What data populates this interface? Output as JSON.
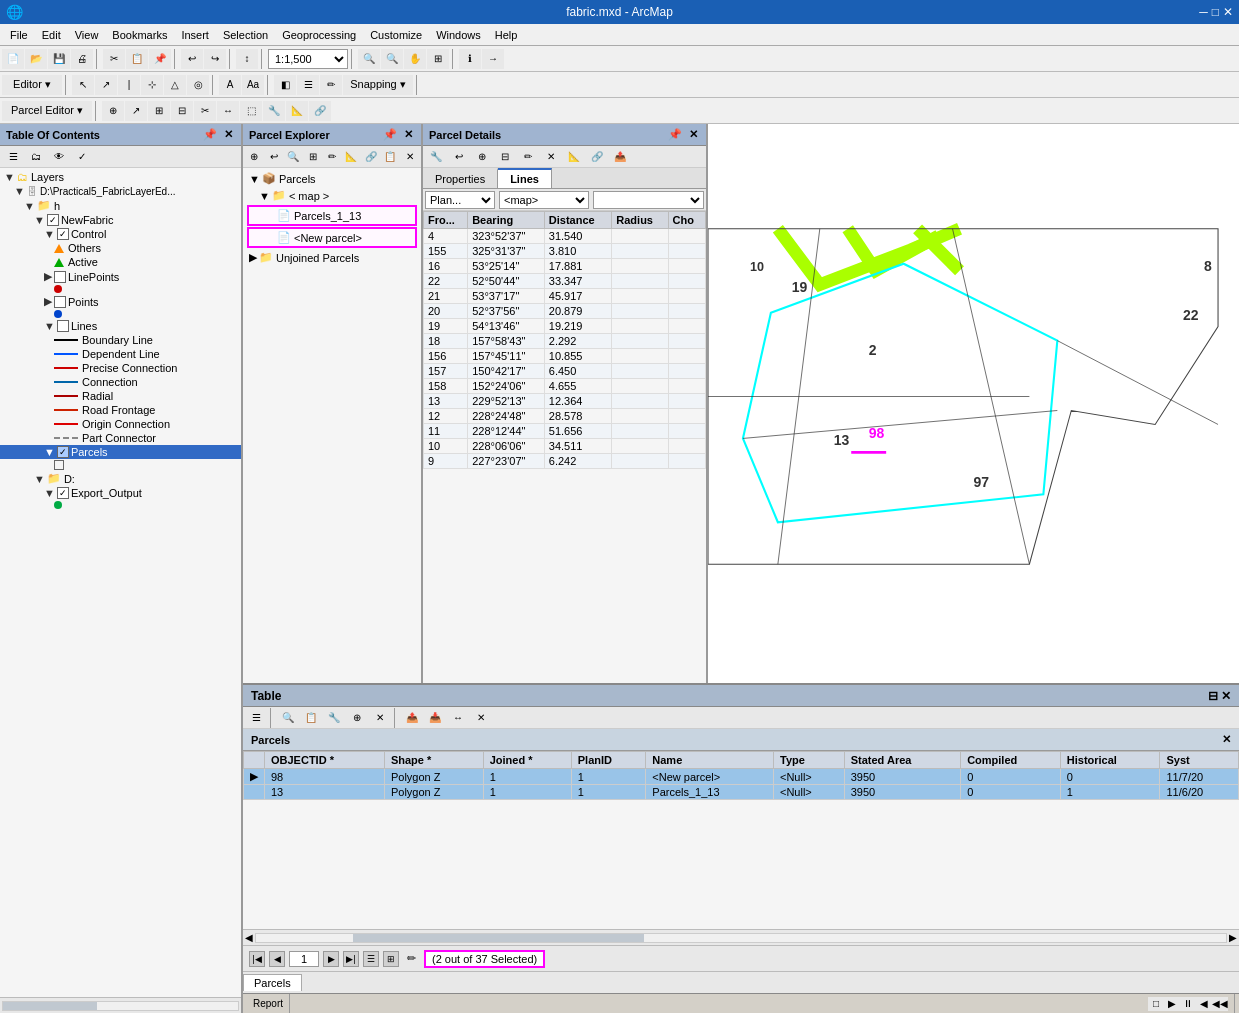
{
  "title": "fabric.mxd - ArcMap",
  "menus": [
    "File",
    "Edit",
    "View",
    "Bookmarks",
    "Insert",
    "Selection",
    "Geoprocessing",
    "Customize",
    "Windows",
    "Help"
  ],
  "toolbar1_dropdown": "1:1,500",
  "toolbar2_label": "Editor ▾",
  "toolbar3_label": "Parcel Editor ▾",
  "snapping_label": "Snapping ▾",
  "toc": {
    "title": "Table Of Contents",
    "sections": [
      {
        "label": "Layers",
        "type": "group",
        "indent": 0
      },
      {
        "label": "D:\\Practical5_FabricLayerEd...",
        "type": "db",
        "indent": 1
      },
      {
        "label": "h",
        "type": "folder",
        "indent": 2
      },
      {
        "label": "NewFabric",
        "type": "layer",
        "checked": true,
        "indent": 3
      },
      {
        "label": "Control",
        "type": "layer",
        "checked": true,
        "indent": 4
      },
      {
        "label": "Others",
        "type": "triangle-orange",
        "indent": 5
      },
      {
        "label": "Active",
        "type": "triangle-green",
        "indent": 5
      },
      {
        "label": "LinePoints",
        "type": "group",
        "checked": false,
        "indent": 4
      },
      {
        "label": "• (red dot)",
        "type": "dot-red",
        "indent": 5
      },
      {
        "label": "Points",
        "type": "group",
        "checked": false,
        "indent": 4
      },
      {
        "label": "• (blue dot)",
        "type": "dot-blue",
        "indent": 5
      },
      {
        "label": "Lines",
        "type": "group",
        "checked": false,
        "indent": 4
      },
      {
        "label": "Boundary Line",
        "type": "line-black",
        "indent": 5
      },
      {
        "label": "Dependent Line",
        "type": "line-blue",
        "indent": 5
      },
      {
        "label": "Precise Connection",
        "type": "line-red",
        "indent": 5
      },
      {
        "label": "Connection",
        "type": "line-blue2",
        "indent": 5
      },
      {
        "label": "Radial",
        "type": "line-red2",
        "indent": 5
      },
      {
        "label": "Road Frontage",
        "type": "line-red3",
        "indent": 5
      },
      {
        "label": "Origin Connection",
        "type": "line-red4",
        "indent": 5
      },
      {
        "label": "Part Connector",
        "type": "line-dash",
        "indent": 5
      },
      {
        "label": "Parcels",
        "type": "layer-blue",
        "checked": true,
        "indent": 4,
        "selected": true
      },
      {
        "label": "□",
        "type": "square",
        "indent": 5
      },
      {
        "label": "D:",
        "type": "folder",
        "indent": 3
      },
      {
        "label": "Export_Output",
        "type": "layer",
        "checked": true,
        "indent": 4
      },
      {
        "label": "● (green)",
        "type": "dot-green",
        "indent": 5
      }
    ]
  },
  "parcel_explorer": {
    "title": "Parcel Explorer",
    "root": "Parcels",
    "items": [
      {
        "label": "< map >",
        "type": "folder",
        "indent": 0
      },
      {
        "label": "Parcels_1_13",
        "type": "parcel",
        "indent": 1,
        "selected_pink": true
      },
      {
        "label": "<New parcel>",
        "type": "parcel",
        "indent": 1,
        "selected_pink": true
      },
      {
        "label": "Unjoined Parcels",
        "type": "folder",
        "indent": 0
      }
    ]
  },
  "parcel_details": {
    "title": "Parcel Details",
    "tabs": [
      "Properties",
      "Lines"
    ],
    "active_tab": "Lines",
    "plan_value": "Plan...",
    "map_value": "<map>",
    "columns": [
      "Fro...",
      "Bearing",
      "Distance",
      "Radius",
      "Cho"
    ],
    "rows": [
      [
        "4",
        "323°52'37\"",
        "31.540",
        "",
        ""
      ],
      [
        "155",
        "325°31'37\"",
        "3.810",
        "",
        ""
      ],
      [
        "16",
        "53°25'14\"",
        "17.881",
        "",
        ""
      ],
      [
        "22",
        "52°50'44\"",
        "33.347",
        "",
        ""
      ],
      [
        "21",
        "53°37'17\"",
        "45.917",
        "",
        ""
      ],
      [
        "20",
        "52°37'56\"",
        "20.879",
        "",
        ""
      ],
      [
        "19",
        "54°13'46\"",
        "19.219",
        "",
        ""
      ],
      [
        "18",
        "157°58'43\"",
        "2.292",
        "",
        ""
      ],
      [
        "156",
        "157°45'11\"",
        "10.855",
        "",
        ""
      ],
      [
        "157",
        "150°42'17\"",
        "6.450",
        "",
        ""
      ],
      [
        "158",
        "152°24'06\"",
        "4.655",
        "",
        ""
      ],
      [
        "13",
        "229°52'13\"",
        "12.364",
        "",
        ""
      ],
      [
        "12",
        "228°24'48\"",
        "28.578",
        "",
        ""
      ],
      [
        "11",
        "228°12'44\"",
        "51.656",
        "",
        ""
      ],
      [
        "10",
        "228°06'06\"",
        "34.511",
        "",
        ""
      ],
      [
        "9",
        "227°23'07\"",
        "6.242",
        "",
        ""
      ]
    ]
  },
  "table": {
    "title": "Table",
    "parcel_title": "Parcels",
    "columns": [
      "OBJECTID *",
      "Shape *",
      "Joined *",
      "PlanID",
      "Name",
      "Type",
      "Stated Area",
      "Compiled",
      "Historical",
      "Syst"
    ],
    "rows": [
      {
        "selected": true,
        "indicator": "▶",
        "cells": [
          "98",
          "Polygon Z",
          "1",
          "1",
          "<New parcel>",
          "<Null>",
          "3950",
          "0",
          "0",
          "11/7/20"
        ]
      },
      {
        "selected": true,
        "indicator": "",
        "cells": [
          "13",
          "Polygon Z",
          "1",
          "1",
          "Parcels_1_13",
          "<Null>",
          "3950",
          "0",
          "1",
          "11/6/20"
        ]
      }
    ],
    "page": "1",
    "selection_text": "(2 out of 37 Selected)",
    "tab_label": "Parcels"
  },
  "map": {
    "labels": [
      "10",
      "19",
      "2",
      "13",
      "98",
      "97",
      "22",
      "8"
    ]
  },
  "status": {
    "report_label": "Report"
  }
}
